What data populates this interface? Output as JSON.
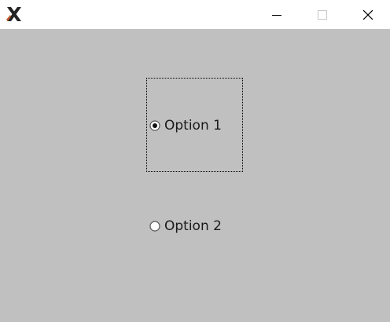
{
  "window": {
    "app_icon": "x-logo-icon",
    "controls": {
      "minimize_icon": "minimize-icon",
      "maximize_icon": "maximize-icon",
      "close_icon": "close-icon"
    }
  },
  "radio_group": {
    "options": [
      {
        "label": "Option 1",
        "selected": true,
        "focused": true
      },
      {
        "label": "Option 2",
        "selected": false,
        "focused": false
      }
    ]
  },
  "colors": {
    "titlebar_bg": "#ffffff",
    "client_bg": "#c0c0c0",
    "text": "#1a1a1a",
    "radio_fill": "#ffffff",
    "radio_ring": "#555555"
  }
}
